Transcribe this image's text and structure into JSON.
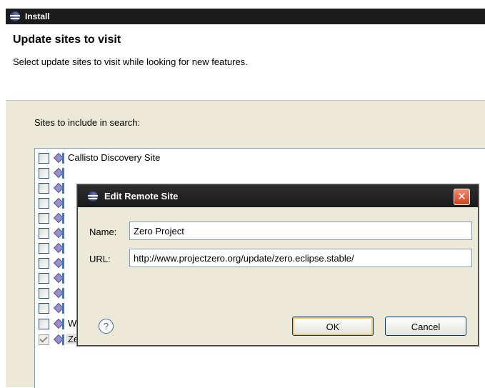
{
  "install": {
    "window_title": "Install",
    "page_title": "Update sites to visit",
    "page_description": "Select update sites to visit while looking for new features.",
    "sites_label": "Sites to include in search:",
    "sites": [
      {
        "label": "Callisto Discovery Site",
        "checked": false
      },
      {
        "label": "",
        "checked": false
      },
      {
        "label": "",
        "checked": false
      },
      {
        "label": "",
        "checked": false
      },
      {
        "label": "",
        "checked": false
      },
      {
        "label": "",
        "checked": false
      },
      {
        "label": "",
        "checked": false
      },
      {
        "label": "",
        "checked": false
      },
      {
        "label": "",
        "checked": false
      },
      {
        "label": "",
        "checked": false
      },
      {
        "label": "",
        "checked": false
      },
      {
        "label": "Web Tools Platform (WTP) Updates",
        "checked": false
      },
      {
        "label": "Zero Project",
        "checked": true
      }
    ]
  },
  "edit_dialog": {
    "title": "Edit Remote Site",
    "close_glyph": "✕",
    "name_label": "Name:",
    "name_value": "Zero Project",
    "url_label": "URL:",
    "url_value": "http://www.projectzero.org/update/zero.eclipse.stable/",
    "help_glyph": "?",
    "ok_label": "OK",
    "cancel_label": "Cancel"
  },
  "colors": {
    "titlebar": "#1c1c1c",
    "close_button": "#d6401c",
    "checkbox_border": "#1c5180"
  },
  "icons": [
    "eclipse-icon",
    "update-site-icon",
    "close-icon",
    "help-icon"
  ]
}
